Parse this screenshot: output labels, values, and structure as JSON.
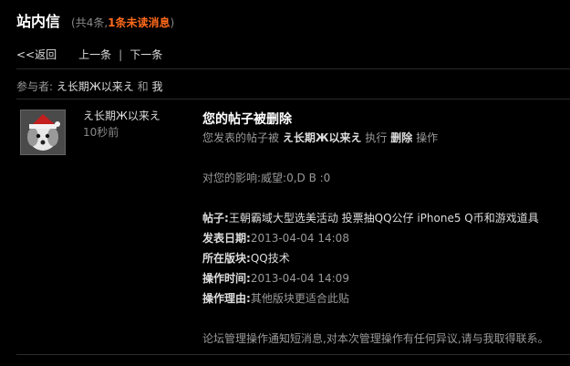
{
  "header": {
    "title": "站内信",
    "subtitle_prefix": "(共4条,",
    "unread": "1条未读消息",
    "subtitle_suffix": ")"
  },
  "nav": {
    "back": "<<返回",
    "prev": "上一条",
    "separator": "|",
    "next": "下一条"
  },
  "participants": {
    "label": "参与者:",
    "user1": "え长期Ж以来え",
    "and": "和",
    "user2": "我"
  },
  "message": {
    "sender": "え长期Ж以来え",
    "time": "10秒前",
    "heading": "您的帖子被删除",
    "line1_prefix": "您发表的帖子被",
    "line1_actor": "え长期Ж以来え",
    "line1_mid": "执行",
    "line1_action": "删除",
    "line1_suffix": "操作",
    "impact": "对您的影响:威望:0,D B :0",
    "post_label": "帖子:",
    "post_value": "王朝霸域大型选美活动 投票抽QQ公仔 iPhone5 Q币和游戏道具",
    "date_label": "发表日期:",
    "date_value": "2013-04-04 14:08",
    "board_label": "所在版块:",
    "board_value": "QQ技术",
    "optime_label": "操作时间:",
    "optime_value": "2013-04-04 14:09",
    "reason_label": "操作理由:",
    "reason_value": "其他版块更适合此贴",
    "footer": "论坛管理操作通知短消息,对本次管理操作有任何异议,请与我取得联系。"
  }
}
